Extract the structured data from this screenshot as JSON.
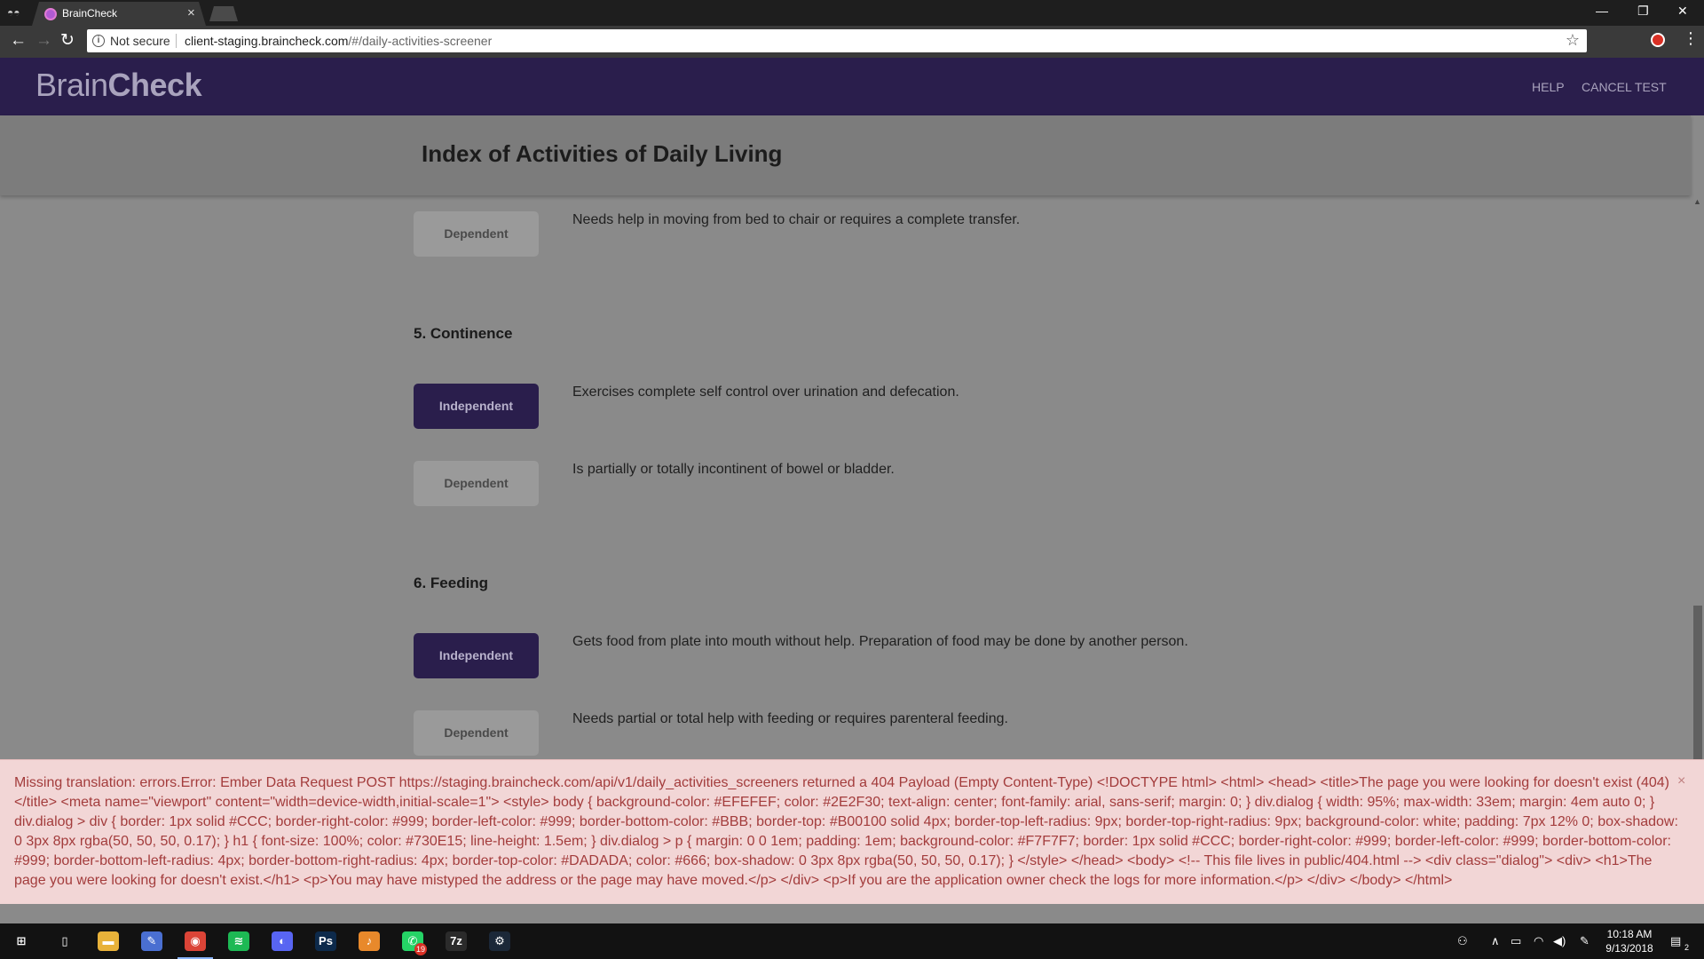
{
  "browser": {
    "tab_title": "BrainCheck",
    "tab_close": "×",
    "security_label": "Not secure",
    "url_host": "client-staging.braincheck.com",
    "url_path": "/#/daily-activities-screener",
    "nav_back": "←",
    "nav_forward": "→",
    "nav_reload": "↻",
    "star": "☆",
    "menu": "⋮",
    "win_minimize": "—",
    "win_restore": "❐",
    "win_close": "✕"
  },
  "app": {
    "logo_light": "Brain",
    "logo_bold": "Check",
    "help_label": "HELP",
    "cancel_label": "CANCEL TEST",
    "page_title": "Index of Activities of Daily Living"
  },
  "sections": {
    "transfer_dependent": {
      "button": "Dependent",
      "description": "Needs help in moving from bed to chair or requires a complete transfer."
    },
    "continence": {
      "title": "5. Continence",
      "independent_button": "Independent",
      "independent_desc": "Exercises complete self control over urination and defecation.",
      "dependent_button": "Dependent",
      "dependent_desc": "Is partially or totally incontinent of bowel or bladder."
    },
    "feeding": {
      "title": "6. Feeding",
      "independent_button": "Independent",
      "independent_desc": "Gets food from plate into mouth without help. Preparation of food may be done by another person.",
      "dependent_button": "Dependent",
      "dependent_desc": "Needs partial or total help with feeding or requires parenteral feeding."
    }
  },
  "error": {
    "message": "Missing translation: errors.Error: Ember Data Request POST https://staging.braincheck.com/api/v1/daily_activities_screeners returned a 404 Payload (Empty Content-Type) <!DOCTYPE html> <html> <head> <title>The page you were looking for doesn't exist (404)</title> <meta name=\"viewport\" content=\"width=device-width,initial-scale=1\"> <style> body { background-color: #EFEFEF; color: #2E2F30; text-align: center; font-family: arial, sans-serif; margin: 0; } div.dialog { width: 95%; max-width: 33em; margin: 4em auto 0; } div.dialog > div { border: 1px solid #CCC; border-right-color: #999; border-left-color: #999; border-bottom-color: #BBB; border-top: #B00100 solid 4px; border-top-left-radius: 9px; border-top-right-radius: 9px; background-color: white; padding: 7px 12% 0; box-shadow: 0 3px 8px rgba(50, 50, 50, 0.17); } h1 { font-size: 100%; color: #730E15; line-height: 1.5em; } div.dialog > p { margin: 0 0 1em; padding: 1em; background-color: #F7F7F7; border: 1px solid #CCC; border-right-color: #999; border-left-color: #999; border-bottom-color: #999; border-bottom-left-radius: 4px; border-bottom-right-radius: 4px; border-top-color: #DADADA; color: #666; box-shadow: 0 3px 8px rgba(50, 50, 50, 0.17); } </style> </head> <body> <!-- This file lives in public/404.html --> <div class=\"dialog\"> <div> <h1>The page you were looking for doesn't exist.</h1> <p>You may have mistyped the address or the page may have moved.</p> </div> <p>If you are the application owner check the logs for more information.</p> </div> </body> </html>",
    "close": "×"
  },
  "taskbar": {
    "items": [
      {
        "name": "windows-start-icon",
        "glyph": "⊞",
        "color": "#121212"
      },
      {
        "name": "task-view-icon",
        "glyph": "▯",
        "color": "#121212"
      },
      {
        "name": "file-explorer-icon",
        "glyph": "▬",
        "color": "#e8b23a"
      },
      {
        "name": "paint-app-icon",
        "glyph": "✎",
        "color": "#4a6fd1"
      },
      {
        "name": "chrome-icon",
        "glyph": "◉",
        "color": "#db4437"
      },
      {
        "name": "spotify-icon",
        "glyph": "≋",
        "color": "#1db954"
      },
      {
        "name": "discord-icon",
        "glyph": "◐",
        "color": "#5865f2"
      },
      {
        "name": "photoshop-icon",
        "glyph": "Ps",
        "color": "#0d2a4b"
      },
      {
        "name": "fl-studio-icon",
        "glyph": "♪",
        "color": "#e8892b"
      },
      {
        "name": "whatsapp-icon",
        "glyph": "✆",
        "color": "#25d366"
      },
      {
        "name": "7zip-icon",
        "glyph": "7z",
        "color": "#2b2b2b"
      },
      {
        "name": "steam-icon",
        "glyph": "⚙",
        "color": "#1b2838"
      }
    ],
    "whatsapp_badge": "19",
    "time": "10:18 AM",
    "date": "9/13/2018",
    "notifications_count": "2"
  },
  "colors": {
    "brand_purple": "#2a1e4c",
    "error_bg": "#f2d6d6",
    "error_text": "#a33c3c"
  }
}
